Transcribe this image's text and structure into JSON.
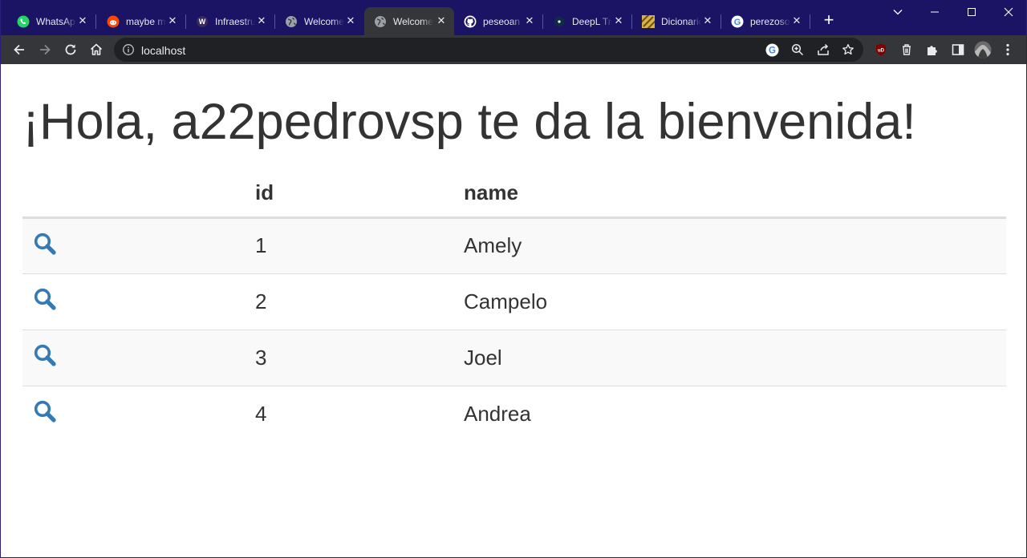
{
  "browser": {
    "tabs": [
      {
        "title": "WhatsApp",
        "favicon": "whatsapp-icon",
        "active": false
      },
      {
        "title": "maybe mark",
        "favicon": "reddit-icon",
        "active": false
      },
      {
        "title": "Infraestructura",
        "favicon": "w-logo-icon",
        "active": false
      },
      {
        "title": "Welcome",
        "favicon": "globe-icon",
        "active": false
      },
      {
        "title": "Welcome",
        "favicon": "globe-icon",
        "active": true
      },
      {
        "title": "peseoan",
        "favicon": "github-icon",
        "active": false
      },
      {
        "title": "DeepL Tr",
        "favicon": "deepl-icon",
        "active": false
      },
      {
        "title": "Dicionario",
        "favicon": "dicionario-icon",
        "active": false
      },
      {
        "title": "perezoso",
        "favicon": "google-icon",
        "active": false
      }
    ],
    "address": {
      "url": "localhost"
    },
    "colors": {
      "tabstrip": "#1b1464",
      "toolbar": "#35363a",
      "omnibox": "#202124"
    }
  },
  "page": {
    "heading": "¡Hola, a22pedrovsp te da la bienvenida!",
    "table": {
      "columns": [
        "",
        "id",
        "name"
      ],
      "rows": [
        {
          "id": "1",
          "name": "Amely"
        },
        {
          "id": "2",
          "name": "Campelo"
        },
        {
          "id": "3",
          "name": "Joel"
        },
        {
          "id": "4",
          "name": "Andrea"
        }
      ],
      "action_icon": "search-icon",
      "action_color": "#337ab7"
    }
  }
}
